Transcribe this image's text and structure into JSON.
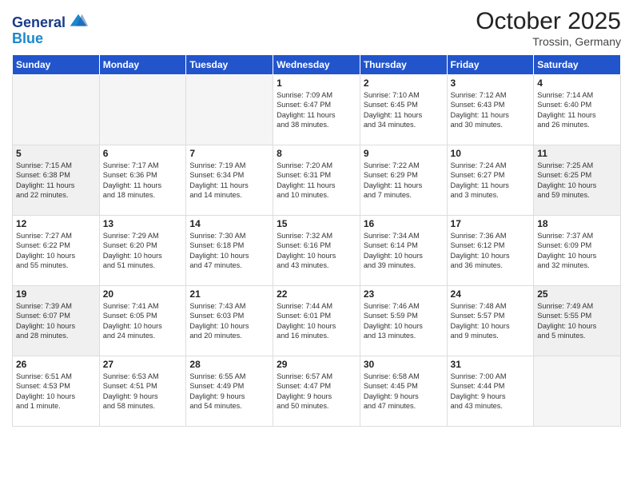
{
  "header": {
    "logo_general": "General",
    "logo_blue": "Blue",
    "month_title": "October 2025",
    "location": "Trossin, Germany"
  },
  "days_of_week": [
    "Sunday",
    "Monday",
    "Tuesday",
    "Wednesday",
    "Thursday",
    "Friday",
    "Saturday"
  ],
  "weeks": [
    [
      {
        "day": "",
        "info": "",
        "empty": true
      },
      {
        "day": "",
        "info": "",
        "empty": true
      },
      {
        "day": "",
        "info": "",
        "empty": true
      },
      {
        "day": "1",
        "info": "Sunrise: 7:09 AM\nSunset: 6:47 PM\nDaylight: 11 hours\nand 38 minutes."
      },
      {
        "day": "2",
        "info": "Sunrise: 7:10 AM\nSunset: 6:45 PM\nDaylight: 11 hours\nand 34 minutes."
      },
      {
        "day": "3",
        "info": "Sunrise: 7:12 AM\nSunset: 6:43 PM\nDaylight: 11 hours\nand 30 minutes."
      },
      {
        "day": "4",
        "info": "Sunrise: 7:14 AM\nSunset: 6:40 PM\nDaylight: 11 hours\nand 26 minutes."
      }
    ],
    [
      {
        "day": "5",
        "info": "Sunrise: 7:15 AM\nSunset: 6:38 PM\nDaylight: 11 hours\nand 22 minutes.",
        "shaded": true
      },
      {
        "day": "6",
        "info": "Sunrise: 7:17 AM\nSunset: 6:36 PM\nDaylight: 11 hours\nand 18 minutes."
      },
      {
        "day": "7",
        "info": "Sunrise: 7:19 AM\nSunset: 6:34 PM\nDaylight: 11 hours\nand 14 minutes."
      },
      {
        "day": "8",
        "info": "Sunrise: 7:20 AM\nSunset: 6:31 PM\nDaylight: 11 hours\nand 10 minutes."
      },
      {
        "day": "9",
        "info": "Sunrise: 7:22 AM\nSunset: 6:29 PM\nDaylight: 11 hours\nand 7 minutes."
      },
      {
        "day": "10",
        "info": "Sunrise: 7:24 AM\nSunset: 6:27 PM\nDaylight: 11 hours\nand 3 minutes."
      },
      {
        "day": "11",
        "info": "Sunrise: 7:25 AM\nSunset: 6:25 PM\nDaylight: 10 hours\nand 59 minutes.",
        "shaded": true
      }
    ],
    [
      {
        "day": "12",
        "info": "Sunrise: 7:27 AM\nSunset: 6:22 PM\nDaylight: 10 hours\nand 55 minutes."
      },
      {
        "day": "13",
        "info": "Sunrise: 7:29 AM\nSunset: 6:20 PM\nDaylight: 10 hours\nand 51 minutes."
      },
      {
        "day": "14",
        "info": "Sunrise: 7:30 AM\nSunset: 6:18 PM\nDaylight: 10 hours\nand 47 minutes."
      },
      {
        "day": "15",
        "info": "Sunrise: 7:32 AM\nSunset: 6:16 PM\nDaylight: 10 hours\nand 43 minutes."
      },
      {
        "day": "16",
        "info": "Sunrise: 7:34 AM\nSunset: 6:14 PM\nDaylight: 10 hours\nand 39 minutes."
      },
      {
        "day": "17",
        "info": "Sunrise: 7:36 AM\nSunset: 6:12 PM\nDaylight: 10 hours\nand 36 minutes."
      },
      {
        "day": "18",
        "info": "Sunrise: 7:37 AM\nSunset: 6:09 PM\nDaylight: 10 hours\nand 32 minutes."
      }
    ],
    [
      {
        "day": "19",
        "info": "Sunrise: 7:39 AM\nSunset: 6:07 PM\nDaylight: 10 hours\nand 28 minutes.",
        "shaded": true
      },
      {
        "day": "20",
        "info": "Sunrise: 7:41 AM\nSunset: 6:05 PM\nDaylight: 10 hours\nand 24 minutes."
      },
      {
        "day": "21",
        "info": "Sunrise: 7:43 AM\nSunset: 6:03 PM\nDaylight: 10 hours\nand 20 minutes."
      },
      {
        "day": "22",
        "info": "Sunrise: 7:44 AM\nSunset: 6:01 PM\nDaylight: 10 hours\nand 16 minutes."
      },
      {
        "day": "23",
        "info": "Sunrise: 7:46 AM\nSunset: 5:59 PM\nDaylight: 10 hours\nand 13 minutes."
      },
      {
        "day": "24",
        "info": "Sunrise: 7:48 AM\nSunset: 5:57 PM\nDaylight: 10 hours\nand 9 minutes."
      },
      {
        "day": "25",
        "info": "Sunrise: 7:49 AM\nSunset: 5:55 PM\nDaylight: 10 hours\nand 5 minutes.",
        "shaded": true
      }
    ],
    [
      {
        "day": "26",
        "info": "Sunrise: 6:51 AM\nSunset: 4:53 PM\nDaylight: 10 hours\nand 1 minute."
      },
      {
        "day": "27",
        "info": "Sunrise: 6:53 AM\nSunset: 4:51 PM\nDaylight: 9 hours\nand 58 minutes."
      },
      {
        "day": "28",
        "info": "Sunrise: 6:55 AM\nSunset: 4:49 PM\nDaylight: 9 hours\nand 54 minutes."
      },
      {
        "day": "29",
        "info": "Sunrise: 6:57 AM\nSunset: 4:47 PM\nDaylight: 9 hours\nand 50 minutes."
      },
      {
        "day": "30",
        "info": "Sunrise: 6:58 AM\nSunset: 4:45 PM\nDaylight: 9 hours\nand 47 minutes."
      },
      {
        "day": "31",
        "info": "Sunrise: 7:00 AM\nSunset: 4:44 PM\nDaylight: 9 hours\nand 43 minutes."
      },
      {
        "day": "",
        "info": "",
        "empty": true
      }
    ]
  ]
}
